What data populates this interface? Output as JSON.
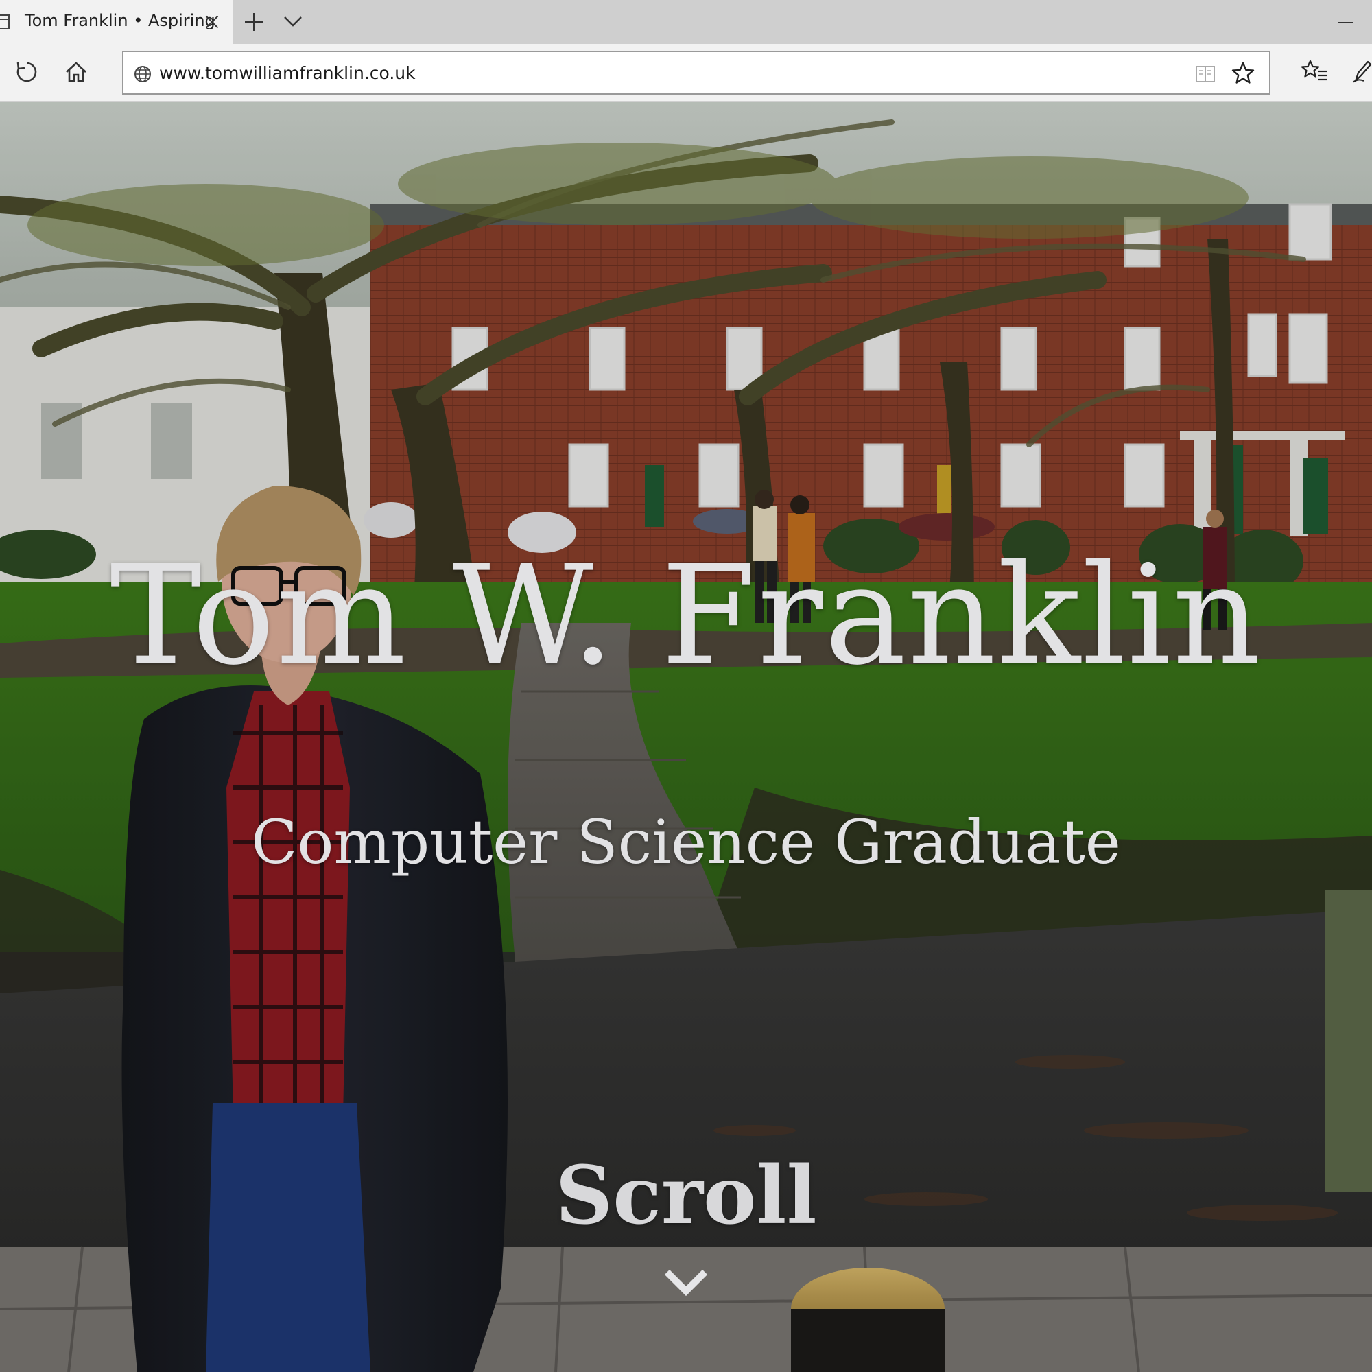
{
  "browser": {
    "tab": {
      "title": "Tom Franklin • Aspiring"
    },
    "address_bar": {
      "url": "www.tomwilliamfranklin.co.uk"
    },
    "icons": [
      "page-icon",
      "close-icon",
      "plus-icon",
      "chevron-down-icon",
      "minimize-icon",
      "refresh-icon",
      "home-icon",
      "globe-icon",
      "reading-view-icon",
      "star-icon",
      "favorites-icon",
      "pen-icon"
    ]
  },
  "hero": {
    "name": "Tom W. Franklin",
    "subtitle": "Computer Science Graduate",
    "scroll_label": "Scroll",
    "scroll_icon": "chevron-down-icon"
  },
  "colors": {
    "hero_text": "#e2e2e4",
    "chrome_bg": "#f2f2f2",
    "tabbar_bg": "#cfcfcf"
  }
}
